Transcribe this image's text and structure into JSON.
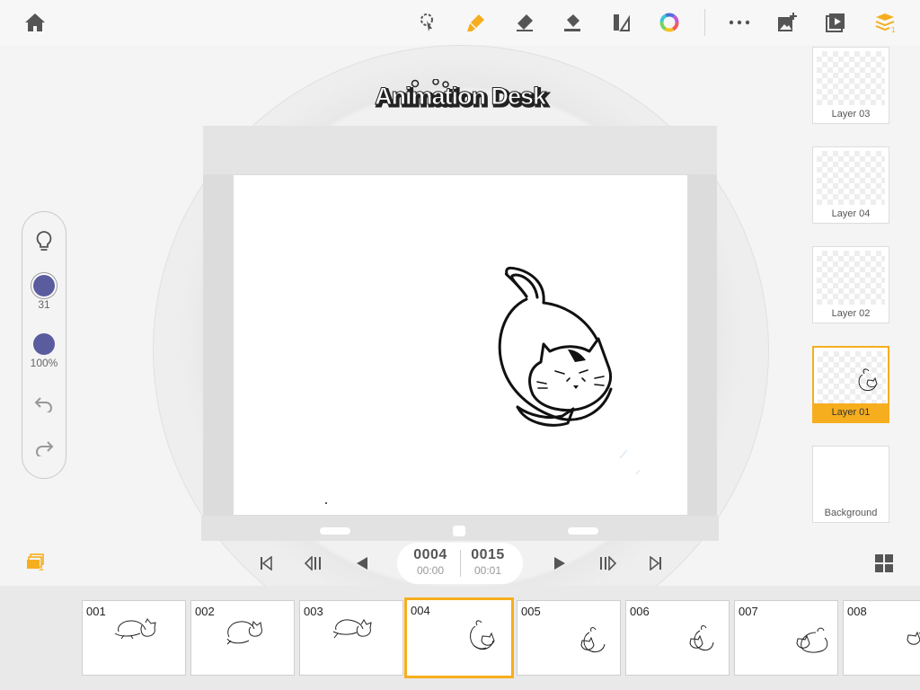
{
  "app": {
    "logo_text": "Animation Desk"
  },
  "toolbar": {
    "left_icons": [
      "home-icon"
    ],
    "tools": [
      "lasso-icon",
      "brush-icon",
      "eraser-icon",
      "fill-bucket-icon",
      "ruler-icon",
      "color-wheel-icon"
    ],
    "right_icons": [
      "more-icon",
      "add-image-icon",
      "play-preview-icon",
      "layers-icon"
    ],
    "accent_color": "#f6ae1e"
  },
  "left_panel": {
    "brush_size": "31",
    "opacity": "100%",
    "color": "#5a5c9e"
  },
  "layers": [
    {
      "name": "Layer 03",
      "active": false
    },
    {
      "name": "Layer 04",
      "active": false
    },
    {
      "name": "Layer 02",
      "active": false
    },
    {
      "name": "Layer 01",
      "active": true
    },
    {
      "name": "Background",
      "active": false
    }
  ],
  "playback": {
    "current_frame": "0004",
    "current_time": "00:00",
    "total_frames": "0015",
    "total_time": "00:01"
  },
  "frames": [
    {
      "label": "001",
      "active": false
    },
    {
      "label": "002",
      "active": false
    },
    {
      "label": "003",
      "active": false
    },
    {
      "label": "004",
      "active": true
    },
    {
      "label": "005",
      "active": false
    },
    {
      "label": "006",
      "active": false
    },
    {
      "label": "007",
      "active": false
    },
    {
      "label": "008",
      "active": false
    }
  ]
}
